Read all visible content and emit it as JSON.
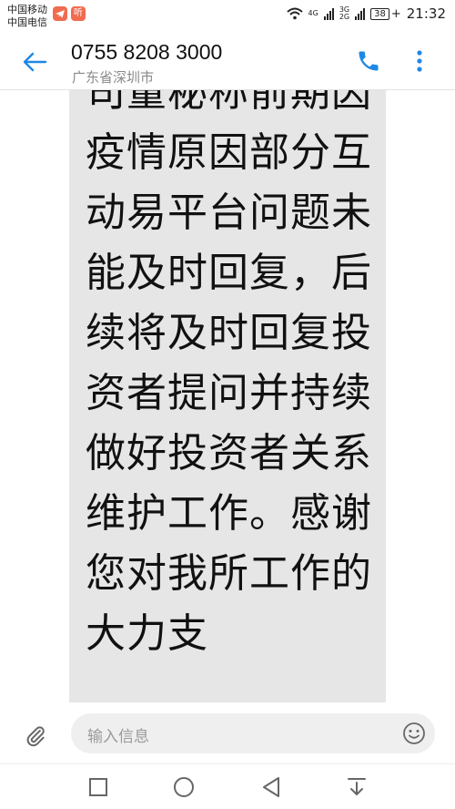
{
  "status_bar": {
    "carrier_1": "中国移动",
    "carrier_2": "中国电信",
    "app_badge_2": "听",
    "net_4g": "4G",
    "net_3g": "3G",
    "net_2g": "2G",
    "battery": "38",
    "battery_plus": "+",
    "time": "21:32"
  },
  "header": {
    "number": "0755 8208 3000",
    "location": "广东省深圳市"
  },
  "message": {
    "text": "司董秘称前期因疫情原因部分互动易平台问题未能及时回复，后续将及时回复投资者提问并持续做好投资者关系维护工作。感谢您对我所工作的大力支"
  },
  "compose": {
    "placeholder": "输入信息"
  },
  "colors": {
    "accent": "#1e88e5",
    "bubble": "#e6e6e6",
    "input_bg": "#efefef"
  },
  "icons": [
    "back-arrow-icon",
    "phone-icon",
    "more-vert-icon",
    "paperclip-icon",
    "emoji-icon",
    "square-icon",
    "circle-icon",
    "triangle-back-icon",
    "download-icon"
  ]
}
